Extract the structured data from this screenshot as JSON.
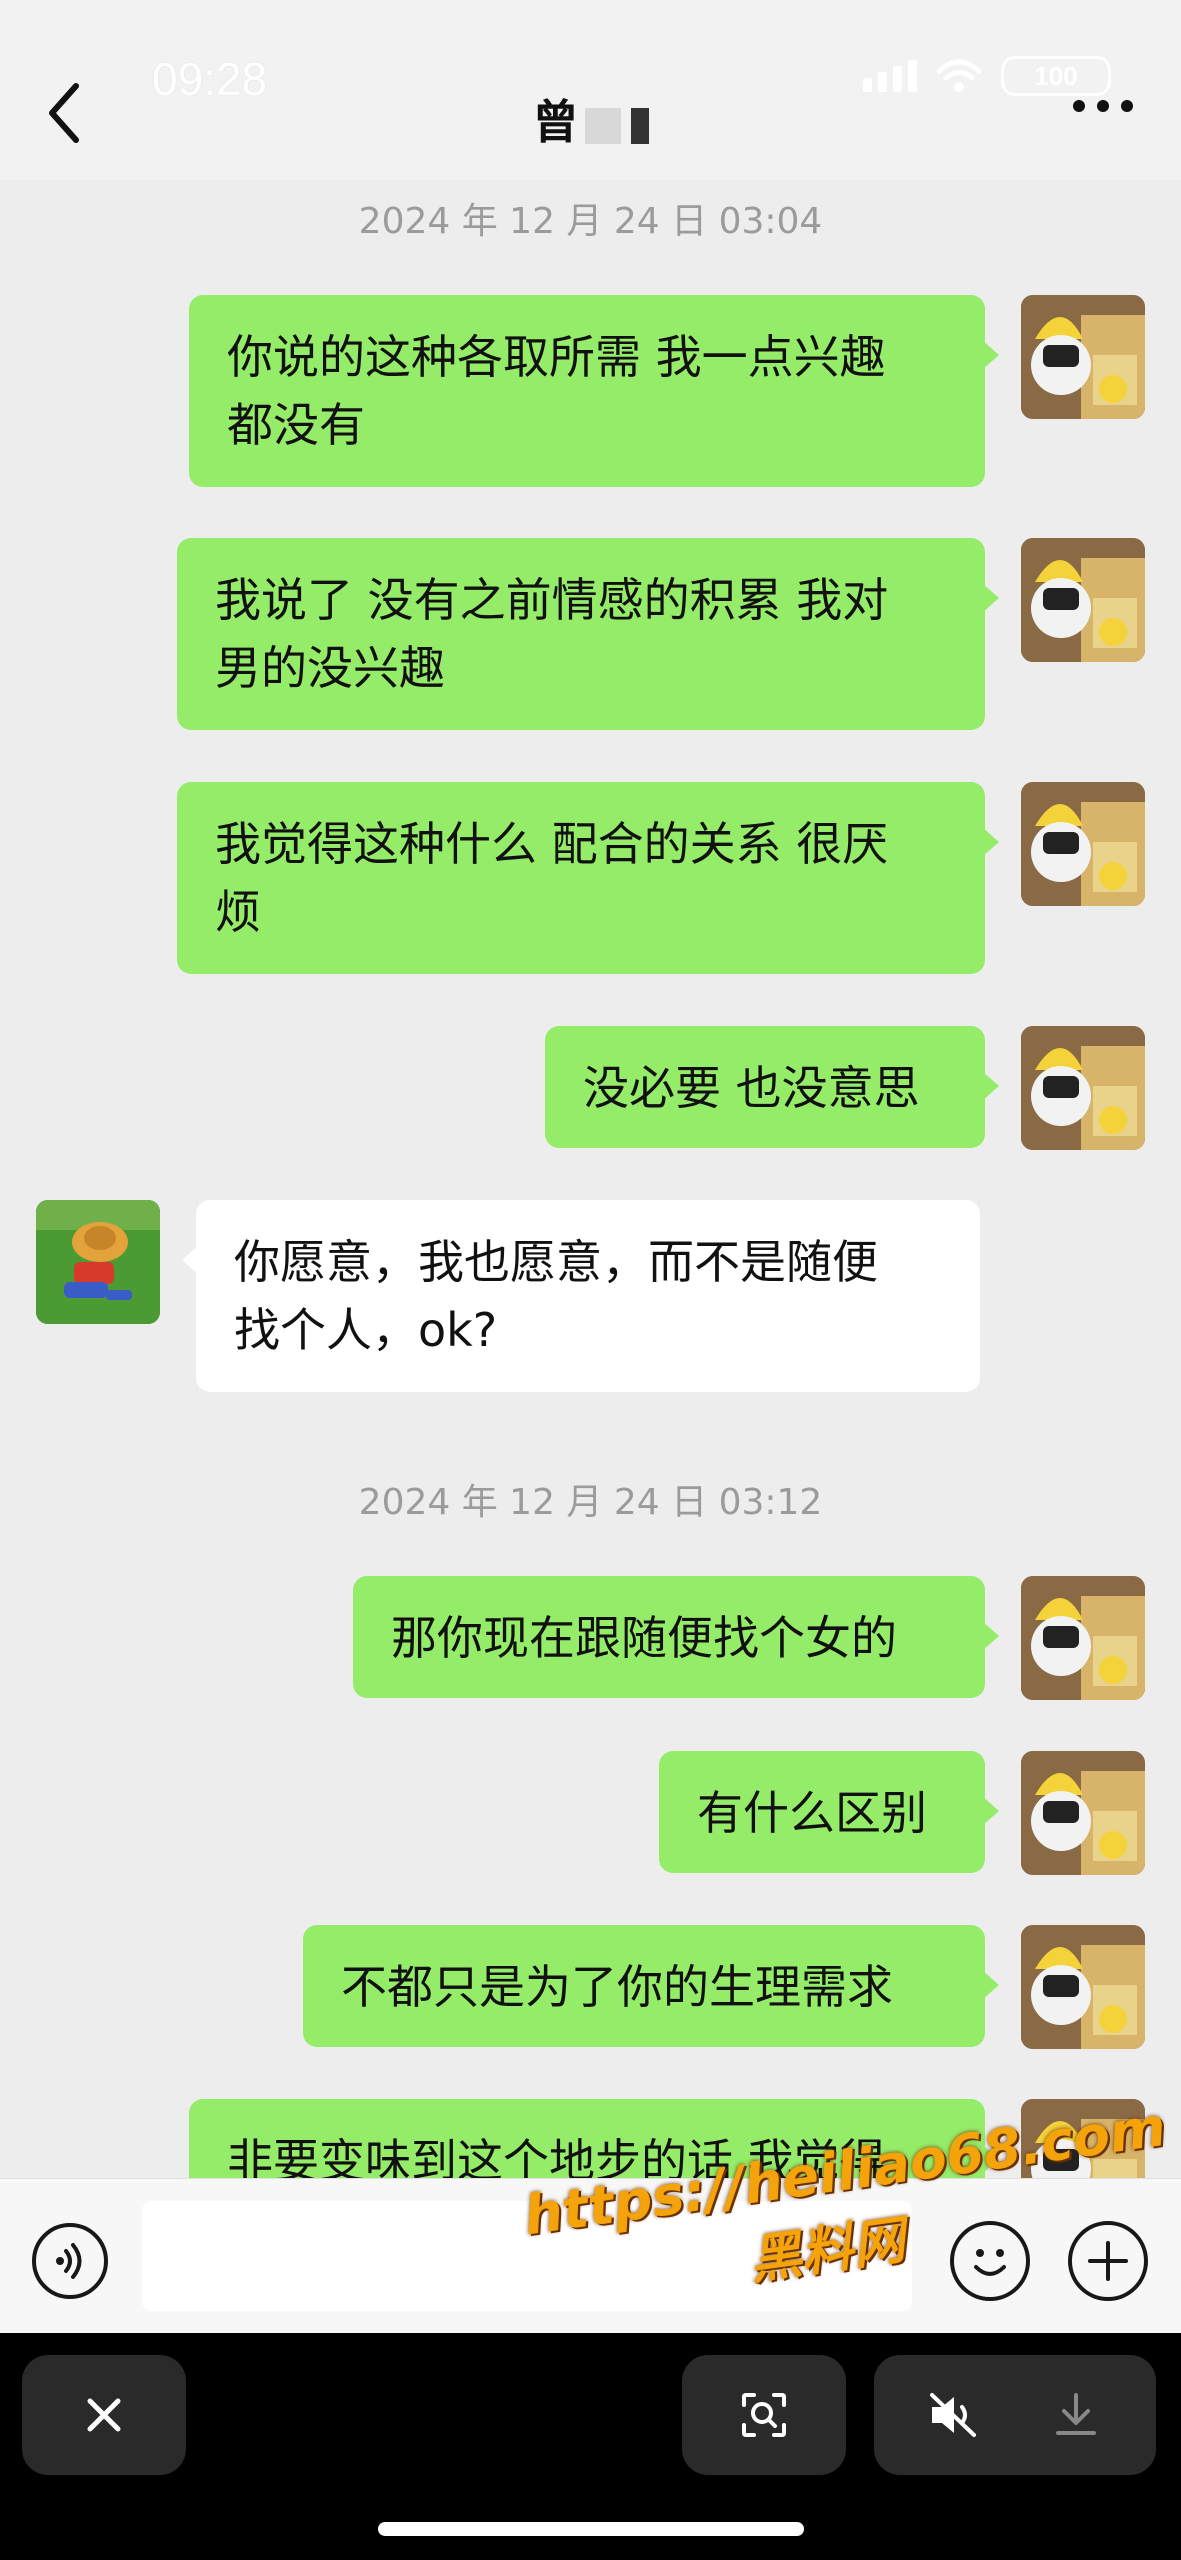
{
  "status_bar": {
    "time": "09:28",
    "battery": "100"
  },
  "header": {
    "title": "曾"
  },
  "timestamps": [
    "2024 年 12 月 24 日 03:04",
    "2024 年 12 月 24 日 03:12"
  ],
  "messages": [
    {
      "sender": "me",
      "lines": [
        "你说的这种各取所需 我一点兴趣",
        "都没有"
      ]
    },
    {
      "sender": "me",
      "lines": [
        "我说了 没有之前情感的积累 我对",
        "男的没兴趣"
      ]
    },
    {
      "sender": "me",
      "lines": [
        "我觉得这种什么 配合的关系 很厌",
        "烦"
      ]
    },
    {
      "sender": "me",
      "lines": [
        "没必要 也没意思"
      ]
    },
    {
      "sender": "other",
      "lines": [
        "你愿意，我也愿意，而不是随便",
        "找个人，ok?"
      ]
    },
    {
      "sender": "me",
      "lines": [
        "那你现在跟随便找个女的"
      ]
    },
    {
      "sender": "me",
      "lines": [
        "有什么区别"
      ]
    },
    {
      "sender": "me",
      "lines": [
        "不都只是为了你的生理需求"
      ]
    },
    {
      "sender": "me",
      "lines": [
        "非要变味到这个地步的话 我觉得"
      ]
    }
  ],
  "watermark": {
    "url": "https://heiliao68.com",
    "name": "黑料网"
  },
  "icons": {
    "back": "chevron-left-icon",
    "more": "more-dots-icon",
    "voice": "voice-input-icon",
    "emoji": "emoji-icon",
    "plus": "plus-icon",
    "close": "close-icon",
    "scan": "scan-text-icon",
    "mute": "mute-icon",
    "download": "download-icon"
  },
  "colors": {
    "my_bubble": "#95ec69",
    "other_bubble": "#ffffff",
    "background": "#ededed"
  }
}
